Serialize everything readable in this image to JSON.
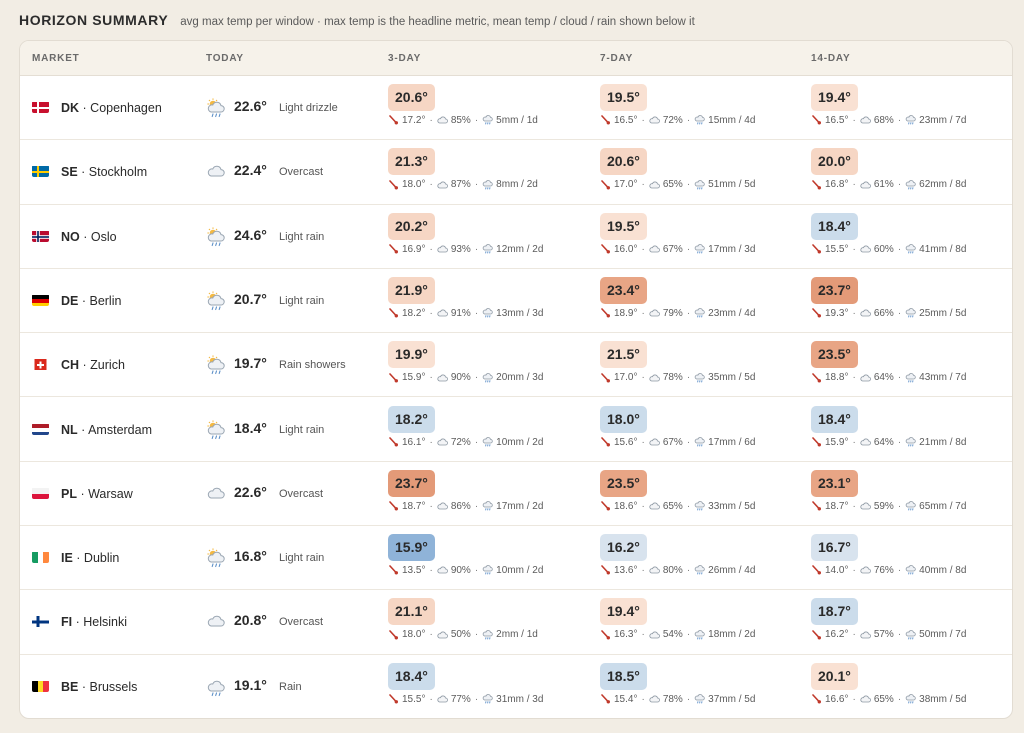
{
  "header": {
    "title": "HORIZON SUMMARY",
    "subtitle": "avg max temp per window · max temp is the headline metric, mean temp / cloud / rain shown below it"
  },
  "columns": {
    "market": "MARKET",
    "today": "TODAY",
    "d3": "3-DAY",
    "d7": "7-DAY",
    "d14": "14-DAY"
  },
  "colors": {
    "warm_light": "#f9e1d3",
    "warm_mid": "#f6d6c4",
    "warm_strong": "#e8a585",
    "warm_stronger": "#e39a78",
    "cool_light": "#d8e3ee",
    "cool_mid": "#cbdceb",
    "cool_strong": "#8fb3d8"
  },
  "rows": [
    {
      "code": "DK",
      "city": "Copenhagen",
      "flag": "dk",
      "icon": "sun-rain-icon",
      "temp": "22.6°",
      "cond": "Light drizzle",
      "windows": [
        {
          "max": "20.6°",
          "tone": "warm_mid",
          "mean": "17.2°",
          "cloud": "85%",
          "rain": "5mm / 1d"
        },
        {
          "max": "19.5°",
          "tone": "warm_light",
          "mean": "16.5°",
          "cloud": "72%",
          "rain": "15mm / 4d"
        },
        {
          "max": "19.4°",
          "tone": "warm_light",
          "mean": "16.5°",
          "cloud": "68%",
          "rain": "23mm / 7d"
        }
      ]
    },
    {
      "code": "SE",
      "city": "Stockholm",
      "flag": "se",
      "icon": "cloud-icon",
      "temp": "22.4°",
      "cond": "Overcast",
      "windows": [
        {
          "max": "21.3°",
          "tone": "warm_mid",
          "mean": "18.0°",
          "cloud": "87%",
          "rain": "8mm / 2d"
        },
        {
          "max": "20.6°",
          "tone": "warm_mid",
          "mean": "17.0°",
          "cloud": "65%",
          "rain": "51mm / 5d"
        },
        {
          "max": "20.0°",
          "tone": "warm_mid",
          "mean": "16.8°",
          "cloud": "61%",
          "rain": "62mm / 8d"
        }
      ]
    },
    {
      "code": "NO",
      "city": "Oslo",
      "flag": "no",
      "icon": "sun-rain-icon",
      "temp": "24.6°",
      "cond": "Light rain",
      "windows": [
        {
          "max": "20.2°",
          "tone": "warm_mid",
          "mean": "16.9°",
          "cloud": "93%",
          "rain": "12mm / 2d"
        },
        {
          "max": "19.5°",
          "tone": "warm_light",
          "mean": "16.0°",
          "cloud": "67%",
          "rain": "17mm / 3d"
        },
        {
          "max": "18.4°",
          "tone": "cool_mid",
          "mean": "15.5°",
          "cloud": "60%",
          "rain": "41mm / 8d"
        }
      ]
    },
    {
      "code": "DE",
      "city": "Berlin",
      "flag": "de",
      "icon": "sun-rain-icon",
      "temp": "20.7°",
      "cond": "Light rain",
      "windows": [
        {
          "max": "21.9°",
          "tone": "warm_mid",
          "mean": "18.2°",
          "cloud": "91%",
          "rain": "13mm / 3d"
        },
        {
          "max": "23.4°",
          "tone": "warm_strong",
          "mean": "18.9°",
          "cloud": "79%",
          "rain": "23mm / 4d"
        },
        {
          "max": "23.7°",
          "tone": "warm_stronger",
          "mean": "19.3°",
          "cloud": "66%",
          "rain": "25mm / 5d"
        }
      ]
    },
    {
      "code": "CH",
      "city": "Zurich",
      "flag": "ch",
      "icon": "sun-rain-icon",
      "temp": "19.7°",
      "cond": "Rain showers",
      "windows": [
        {
          "max": "19.9°",
          "tone": "warm_light",
          "mean": "15.9°",
          "cloud": "90%",
          "rain": "20mm / 3d"
        },
        {
          "max": "21.5°",
          "tone": "warm_light",
          "mean": "17.0°",
          "cloud": "78%",
          "rain": "35mm / 5d"
        },
        {
          "max": "23.5°",
          "tone": "warm_strong",
          "mean": "18.8°",
          "cloud": "64%",
          "rain": "43mm / 7d"
        }
      ]
    },
    {
      "code": "NL",
      "city": "Amsterdam",
      "flag": "nl",
      "icon": "sun-rain-icon",
      "temp": "18.4°",
      "cond": "Light rain",
      "windows": [
        {
          "max": "18.2°",
          "tone": "cool_mid",
          "mean": "16.1°",
          "cloud": "72%",
          "rain": "10mm / 2d"
        },
        {
          "max": "18.0°",
          "tone": "cool_mid",
          "mean": "15.6°",
          "cloud": "67%",
          "rain": "17mm / 6d"
        },
        {
          "max": "18.4°",
          "tone": "cool_mid",
          "mean": "15.9°",
          "cloud": "64%",
          "rain": "21mm / 8d"
        }
      ]
    },
    {
      "code": "PL",
      "city": "Warsaw",
      "flag": "pl",
      "icon": "cloud-icon",
      "temp": "22.6°",
      "cond": "Overcast",
      "windows": [
        {
          "max": "23.7°",
          "tone": "warm_stronger",
          "mean": "18.7°",
          "cloud": "86%",
          "rain": "17mm / 2d"
        },
        {
          "max": "23.5°",
          "tone": "warm_strong",
          "mean": "18.6°",
          "cloud": "65%",
          "rain": "33mm / 5d"
        },
        {
          "max": "23.1°",
          "tone": "warm_strong",
          "mean": "18.7°",
          "cloud": "59%",
          "rain": "65mm / 7d"
        }
      ]
    },
    {
      "code": "IE",
      "city": "Dublin",
      "flag": "ie",
      "icon": "sun-rain-icon",
      "temp": "16.8°",
      "cond": "Light rain",
      "windows": [
        {
          "max": "15.9°",
          "tone": "cool_strong",
          "mean": "13.5°",
          "cloud": "90%",
          "rain": "10mm / 2d"
        },
        {
          "max": "16.2°",
          "tone": "cool_light",
          "mean": "13.6°",
          "cloud": "80%",
          "rain": "26mm / 4d"
        },
        {
          "max": "16.7°",
          "tone": "cool_light",
          "mean": "14.0°",
          "cloud": "76%",
          "rain": "40mm / 8d"
        }
      ]
    },
    {
      "code": "FI",
      "city": "Helsinki",
      "flag": "fi",
      "icon": "cloud-icon",
      "temp": "20.8°",
      "cond": "Overcast",
      "windows": [
        {
          "max": "21.1°",
          "tone": "warm_mid",
          "mean": "18.0°",
          "cloud": "50%",
          "rain": "2mm / 1d"
        },
        {
          "max": "19.4°",
          "tone": "warm_light",
          "mean": "16.3°",
          "cloud": "54%",
          "rain": "18mm / 2d"
        },
        {
          "max": "18.7°",
          "tone": "cool_mid",
          "mean": "16.2°",
          "cloud": "57%",
          "rain": "50mm / 7d"
        }
      ]
    },
    {
      "code": "BE",
      "city": "Brussels",
      "flag": "be",
      "icon": "rain-cloud-icon",
      "temp": "19.1°",
      "cond": "Rain",
      "windows": [
        {
          "max": "18.4°",
          "tone": "cool_mid",
          "mean": "15.5°",
          "cloud": "77%",
          "rain": "31mm / 3d"
        },
        {
          "max": "18.5°",
          "tone": "cool_mid",
          "mean": "15.4°",
          "cloud": "78%",
          "rain": "37mm / 5d"
        },
        {
          "max": "20.1°",
          "tone": "warm_light",
          "mean": "16.6°",
          "cloud": "65%",
          "rain": "38mm / 5d"
        }
      ]
    }
  ]
}
